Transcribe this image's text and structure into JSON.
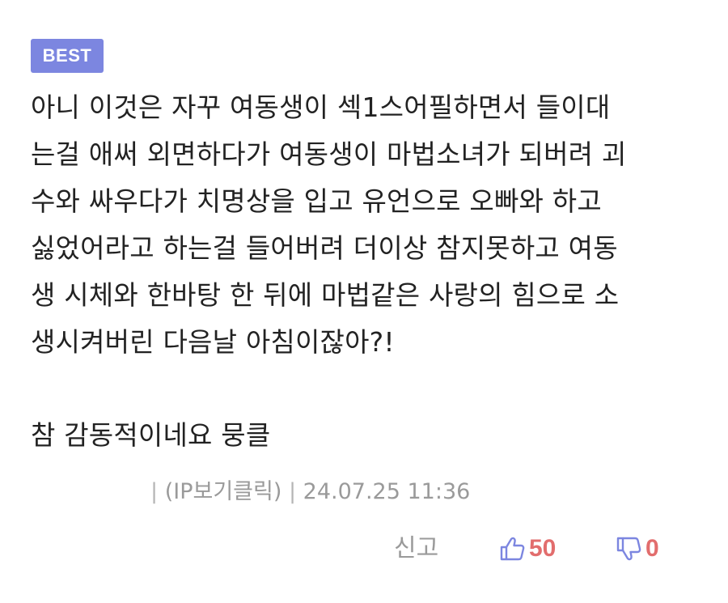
{
  "comment": {
    "badge": "BEST",
    "lines": [
      "아니 이것은 자꾸 여동생이 섹1스어필하면서 들이대",
      "는걸 애써 외면하다가 여동생이 마법소녀가 되버려 괴",
      "수와 싸우다가 치명상을 입고 유언으로 오빠와 하고",
      "싫었어라고 하는걸 들어버려 더이상 참지못하고 여동",
      "생 시체와 한바탕 한 뒤에 마법같은 사랑의 힘으로 소",
      "생시켜버린 다음날 아침이잖아?!",
      "참 감동적이네요 뭉클"
    ],
    "meta": {
      "separator": "|",
      "author": "(IP보기클릭)",
      "date": "24.07.25 11:36"
    },
    "actions": {
      "report": "신고",
      "upvotes": "50",
      "downvotes": "0"
    }
  },
  "colors": {
    "badge": "#7c86e0",
    "upvote_icon": "#7c86e0",
    "downvote_icon": "#7c86e0",
    "vote_count": "#e26d6d",
    "meta_text": "#9a9a9a"
  }
}
